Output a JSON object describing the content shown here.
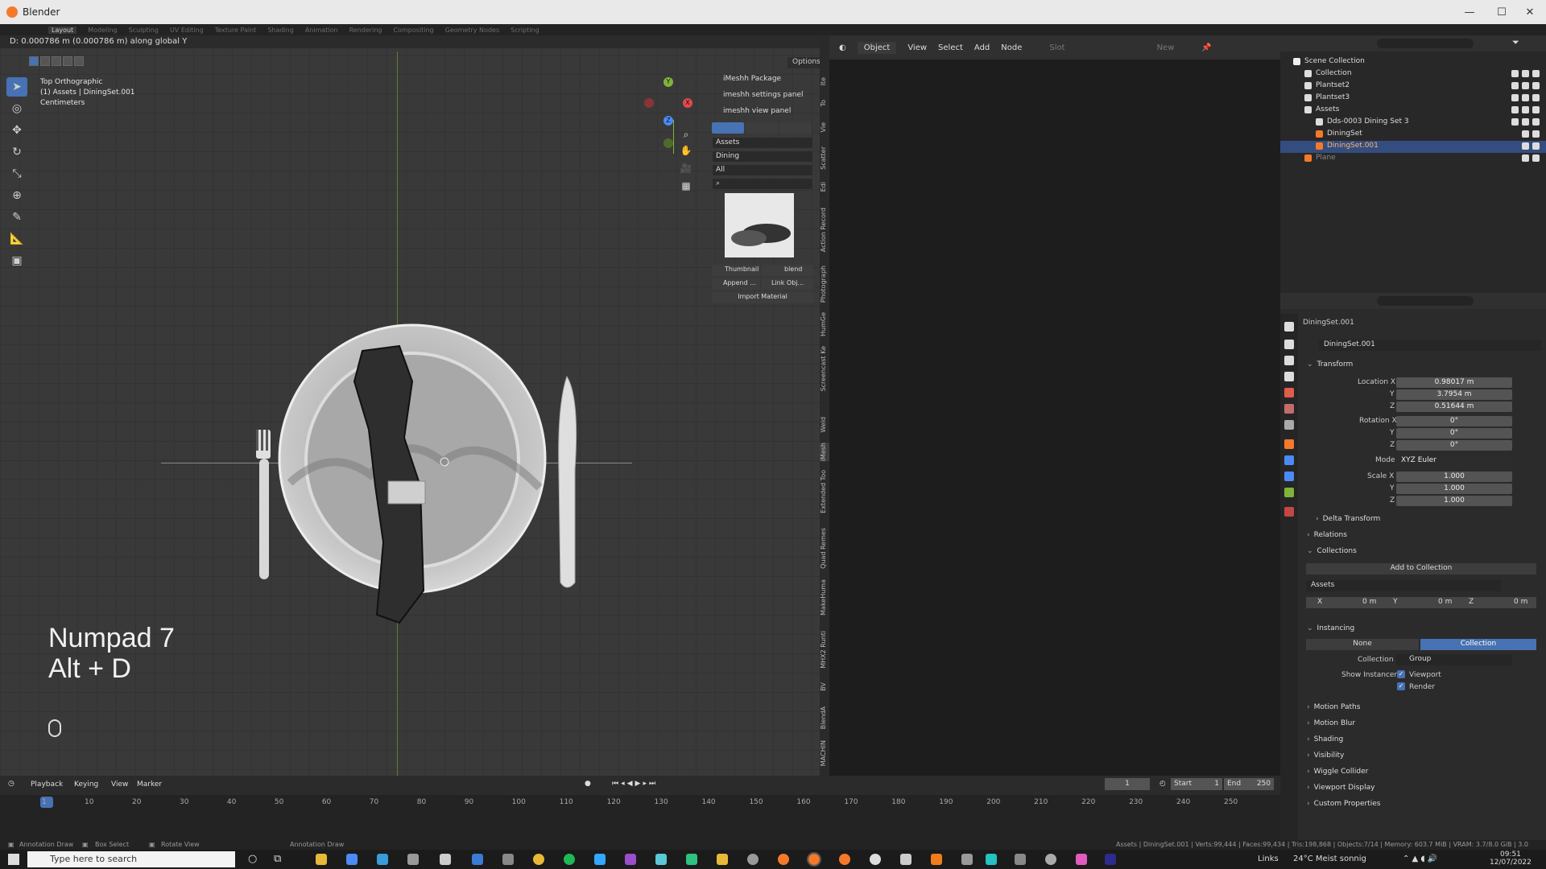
{
  "window": {
    "title": "Blender"
  },
  "workspaces": [
    "Layout",
    "Modeling",
    "Sculpting",
    "UV Editing",
    "Texture Paint",
    "Shading",
    "Animation",
    "Rendering",
    "Compositing",
    "Geometry Nodes",
    "Scripting"
  ],
  "viewport": {
    "status_line": "D: 0.000786 m (0.000786 m) along global Y",
    "options_label": "Options",
    "view_name": "Top Orthographic",
    "active_object": "(1) Assets | DiningSet.001",
    "units": "Centimeters",
    "overlay_line1": "Numpad 7",
    "overlay_line2": "Alt + D",
    "gizmo": {
      "y": "Y",
      "z": "Z",
      "x": "X"
    }
  },
  "npanel": {
    "item1": "iMeshh Package",
    "item2": "imeshh settings panel",
    "item3": "imeshh view panel",
    "select1": "Assets",
    "select2": "Dining",
    "select3": "All",
    "thumbnail_label": "Thumbnail",
    "blend_label": "blend",
    "append_label": "Append ...",
    "link_label": "Link Obj...",
    "import_material_label": "Import Material",
    "side_tabs": [
      "Ite",
      "To",
      "Vie",
      "Scatter",
      "Edi",
      "Action Record",
      "Photograph",
      "HumGe",
      "Screencast Ke",
      "Weld",
      "iMesh",
      "Extended Too",
      "Quad Remes",
      "MakeHuma",
      "MHX2 Runti",
      "BV",
      "BlendA",
      "MACHIN"
    ]
  },
  "node_editor": {
    "mode_label": "Object",
    "menu": [
      "View",
      "Select",
      "Add",
      "Node"
    ],
    "slot_label": "Slot",
    "new_label": "New"
  },
  "outliner": {
    "rows": [
      {
        "label": "Scene Collection",
        "indent": 0
      },
      {
        "label": "Collection",
        "indent": 1
      },
      {
        "label": "Plantset2",
        "indent": 1
      },
      {
        "label": "Plantset3",
        "indent": 1
      },
      {
        "label": "Assets",
        "indent": 1
      },
      {
        "label": "Dds-0003 Dining Set 3",
        "indent": 2
      },
      {
        "label": "DiningSet",
        "indent": 2
      },
      {
        "label": "DiningSet.001",
        "indent": 2
      },
      {
        "label": "Plane",
        "indent": 1
      }
    ]
  },
  "properties": {
    "object_name": "DiningSet.001",
    "object_field": "DiningSet.001",
    "transform_label": "Transform",
    "location_label": "Location X",
    "loc_x": "0.98017 m",
    "loc_y": "3.7954 m",
    "loc_z": "0.51644 m",
    "rotation_label": "Rotation X",
    "rot_x": "0°",
    "rot_y": "0°",
    "rot_z": "0°",
    "mode_label": "Mode",
    "mode_value": "XYZ Euler",
    "scale_label": "Scale X",
    "scale_x": "1.000",
    "scale_y": "1.000",
    "scale_z": "1.000",
    "y_label": "Y",
    "z_label": "Z",
    "delta_transform": "Delta Transform",
    "relations": "Relations",
    "collections": "Collections",
    "add_to_collection": "Add to Collection",
    "collection_name": "Assets",
    "offset_x_label": "X",
    "offset_x": "0 m",
    "offset_y_label": "Y",
    "offset_y": "0 m",
    "offset_z_label": "Z",
    "offset_z": "0 m",
    "instancing": "Instancing",
    "inst_none": "None",
    "inst_collection": "Collection",
    "collection_label": "Collection",
    "collection_value": "Group",
    "show_instancer_label": "Show Instancer",
    "viewport_check": "Viewport",
    "render_check": "Render",
    "motion_paths": "Motion Paths",
    "motion_blur": "Motion Blur",
    "shading": "Shading",
    "visibility": "Visibility",
    "wiggle_collider": "Wiggle Collider",
    "viewport_display": "Viewport Display",
    "custom_properties": "Custom Properties"
  },
  "timeline": {
    "menu": [
      "Playback",
      "Keying",
      "View",
      "Marker"
    ],
    "current_frame": "1",
    "start_label": "Start",
    "start_value": "1",
    "end_label": "End",
    "end_value": "250",
    "ticks": [
      "1",
      "10",
      "20",
      "30",
      "40",
      "50",
      "60",
      "70",
      "80",
      "90",
      "100",
      "110",
      "120",
      "130",
      "140",
      "150",
      "160",
      "170",
      "180",
      "190",
      "200",
      "210",
      "220",
      "230",
      "240",
      "250"
    ]
  },
  "statusbar": {
    "item1": "Annotation Draw",
    "item2": "Box Select",
    "item3": "Rotate View",
    "item4": "Annotation Draw",
    "stats": "Assets | DiningSet.001 | Verts:99,444 | Faces:99,434 | Tris:198,868 | Objects:7/14 | Memory: 603.7 MiB | VRAM: 3.7/8.0 GiB | 3.0"
  },
  "taskbar": {
    "search_placeholder": "Type here to search",
    "links_label": "Links",
    "weather": "24°C  Meist sonnig",
    "time": "09:51",
    "date": "12/07/2022"
  }
}
